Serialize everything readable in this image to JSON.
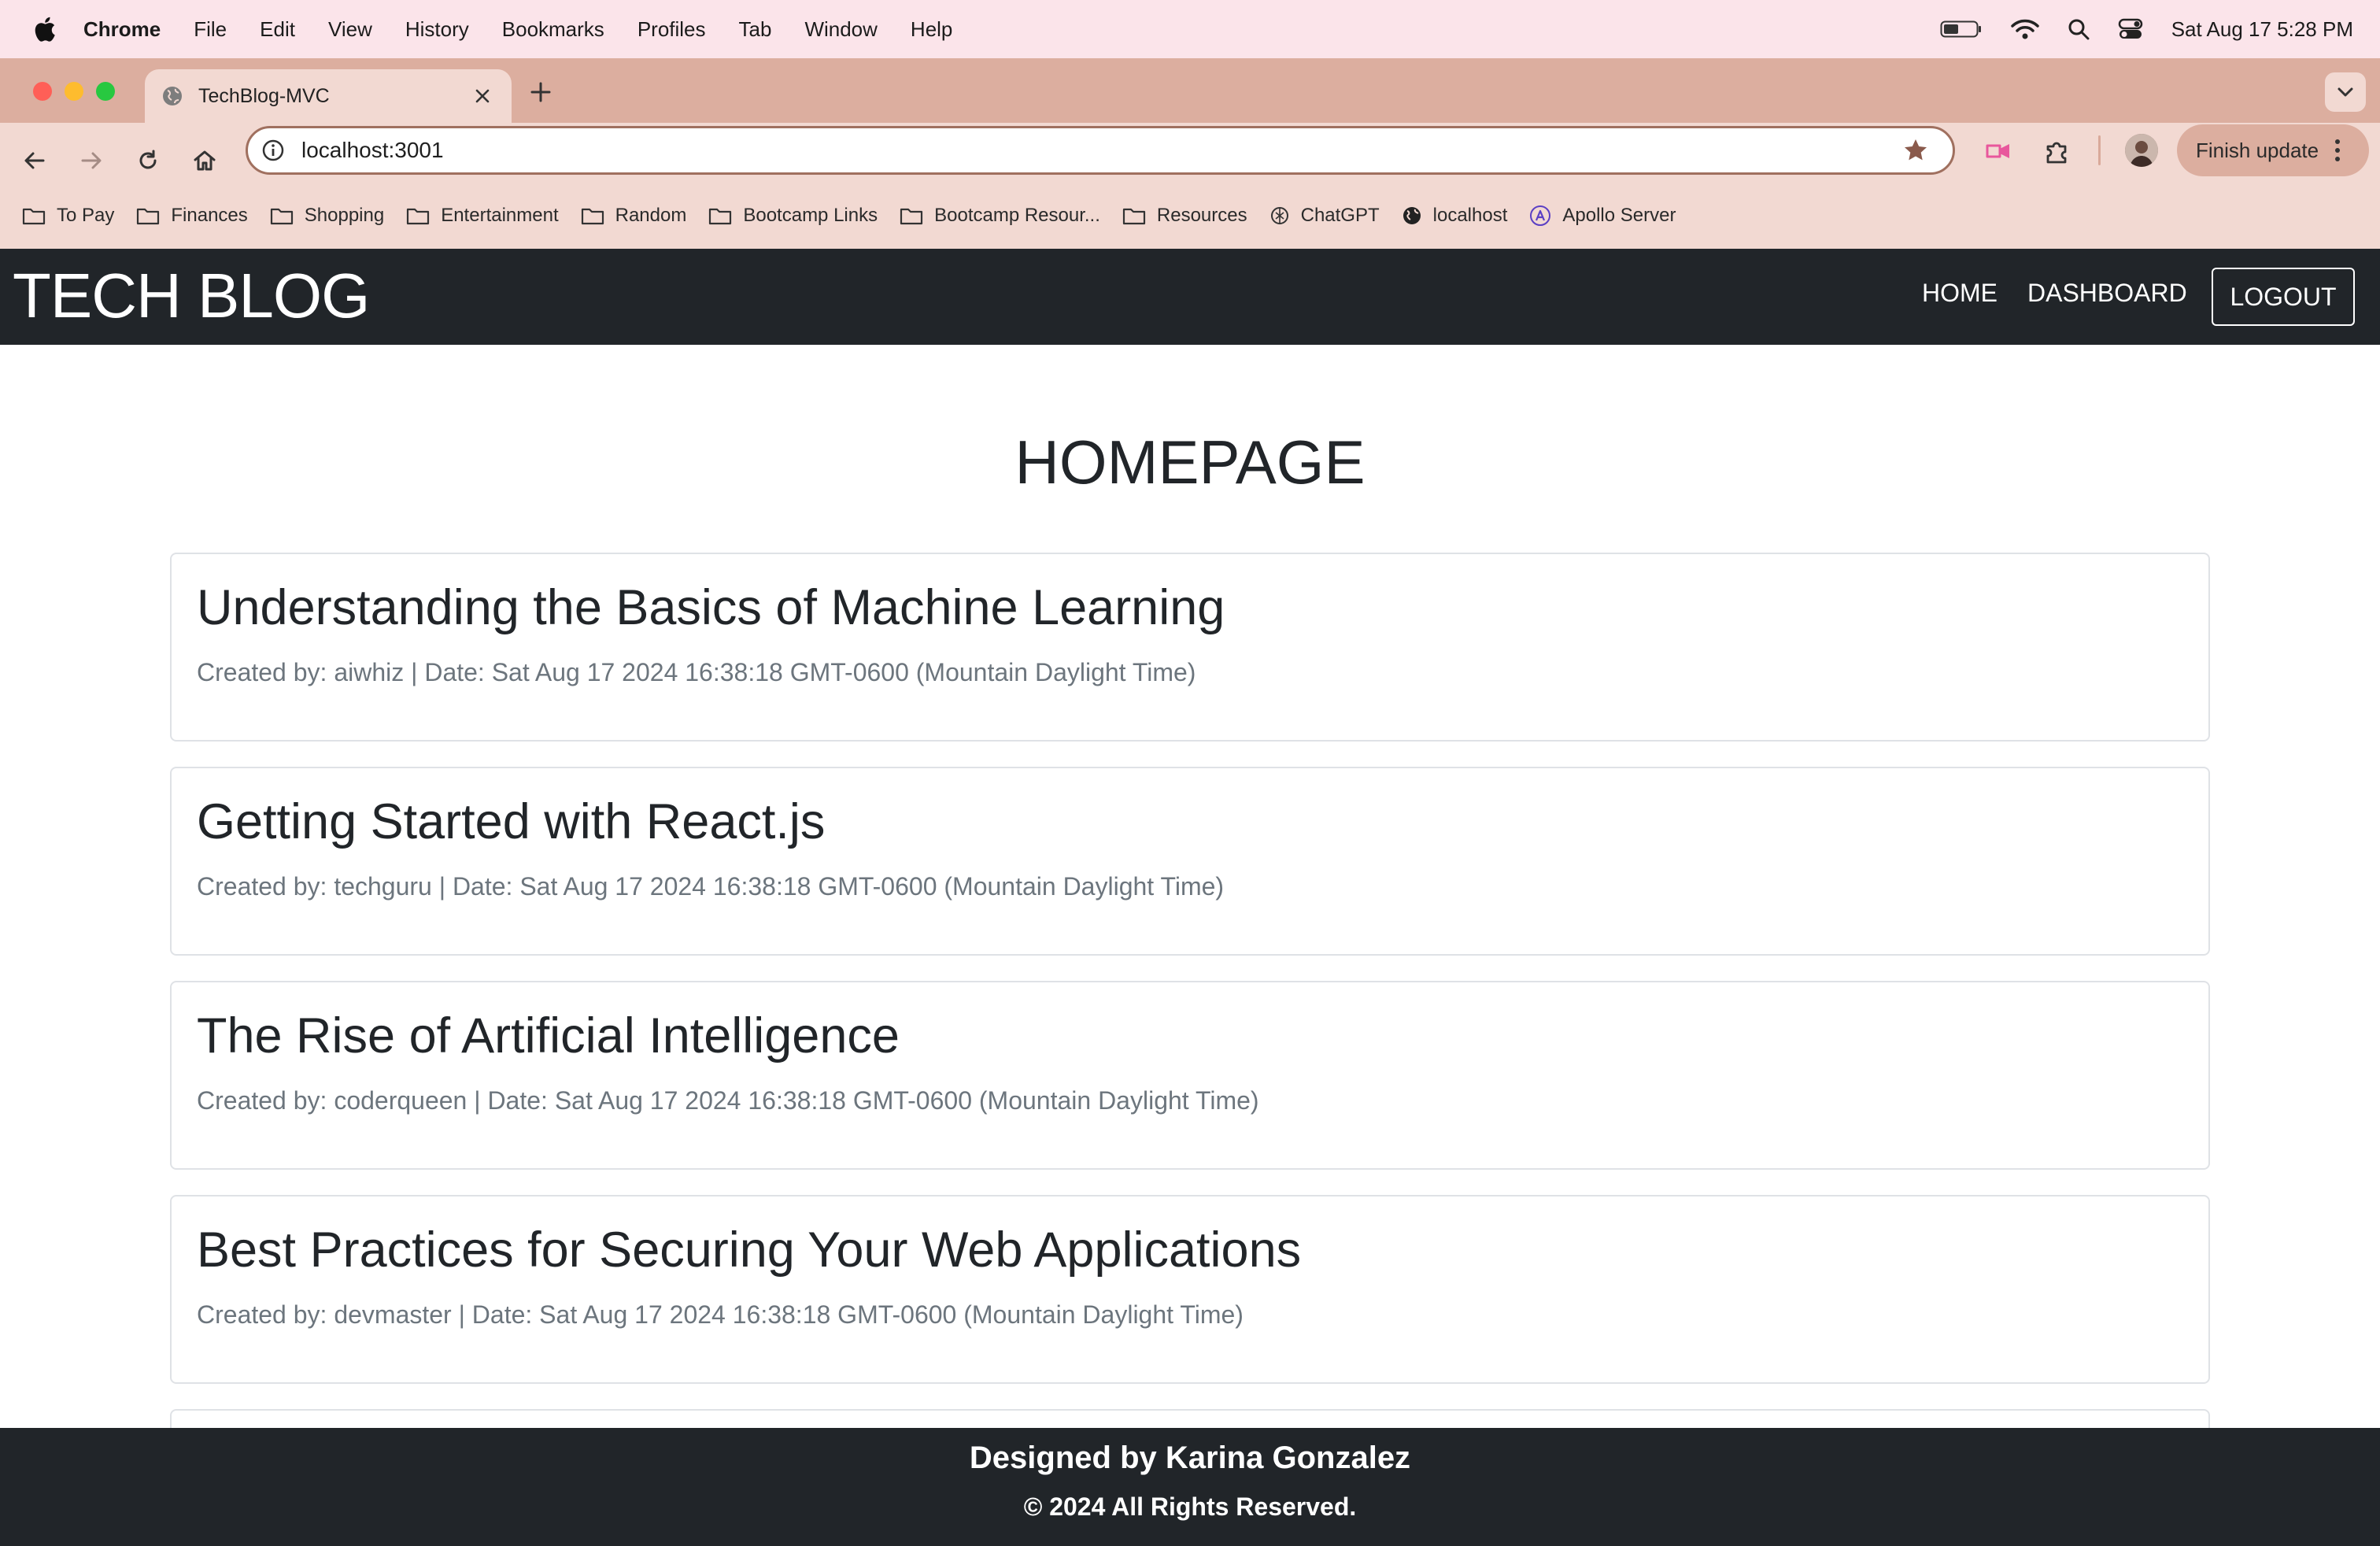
{
  "menubar": {
    "app_name": "Chrome",
    "menus": [
      "File",
      "Edit",
      "View",
      "History",
      "Bookmarks",
      "Profiles",
      "Tab",
      "Window",
      "Help"
    ],
    "clock": "Sat Aug 17  5:28 PM"
  },
  "browser": {
    "tab_title": "TechBlog-MVC",
    "url": "localhost:3001",
    "finish_update_label": "Finish update",
    "bookmarks": [
      {
        "label": "To Pay",
        "icon": "folder-icon"
      },
      {
        "label": "Finances",
        "icon": "folder-icon"
      },
      {
        "label": "Shopping",
        "icon": "folder-icon"
      },
      {
        "label": "Entertainment",
        "icon": "folder-icon"
      },
      {
        "label": "Random",
        "icon": "folder-icon"
      },
      {
        "label": "Bootcamp Links",
        "icon": "folder-icon"
      },
      {
        "label": "Bootcamp Resour...",
        "icon": "folder-icon"
      },
      {
        "label": "Resources",
        "icon": "folder-icon"
      },
      {
        "label": "ChatGPT",
        "icon": "chatgpt-icon"
      },
      {
        "label": "localhost",
        "icon": "globe-icon"
      },
      {
        "label": "Apollo Server",
        "icon": "apollo-icon"
      }
    ]
  },
  "site": {
    "brand": "TECH BLOG",
    "nav": {
      "home": "HOME",
      "dashboard": "DASHBOARD",
      "logout": "LOGOUT"
    },
    "page_title": "HOMEPAGE",
    "posts": [
      {
        "title": "Understanding the Basics of Machine Learning",
        "meta": "Created by: aiwhiz | Date: Sat Aug 17 2024 16:38:18 GMT-0600 (Mountain Daylight Time)"
      },
      {
        "title": "Getting Started with React.js",
        "meta": "Created by: techguru | Date: Sat Aug 17 2024 16:38:18 GMT-0600 (Mountain Daylight Time)"
      },
      {
        "title": "The Rise of Artificial Intelligence",
        "meta": "Created by: coderqueen | Date: Sat Aug 17 2024 16:38:18 GMT-0600 (Mountain Daylight Time)"
      },
      {
        "title": "Best Practices for Securing Your Web Applications",
        "meta": "Created by: devmaster | Date: Sat Aug 17 2024 16:38:18 GMT-0600 (Mountain Daylight Time)"
      }
    ],
    "footer": {
      "designed_by": "Designed by Karina Gonzalez",
      "rights": "© 2024 All Rights Reserved."
    }
  },
  "colors": {
    "menubar_bg": "#fbe4ea",
    "tabstrip_bg": "#dcae9f",
    "toolbar_bg": "#f2d9d2",
    "navbar_bg": "#212529",
    "meta_text": "#6c757d"
  }
}
